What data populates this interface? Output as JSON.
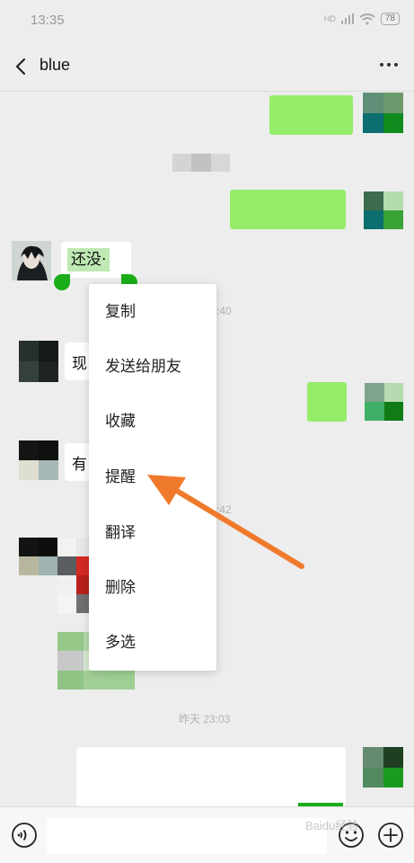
{
  "status_bar": {
    "time": "13:35",
    "network_label": "HD",
    "battery": "78"
  },
  "header": {
    "title": "blue",
    "back_icon": "chevron-left-icon",
    "more_icon": "ellipsis-icon"
  },
  "messages": {
    "partial_text_1": "还没·",
    "partial_text_2": "现",
    "partial_text_3": "有",
    "partial_time_1": ":40",
    "partial_time_2": ":42",
    "timestamp_3": "昨天 23:03"
  },
  "context_menu": {
    "items": [
      "复制",
      "发送给朋友",
      "收藏",
      "提醒",
      "翻译",
      "删除",
      "多选"
    ]
  },
  "input_bar": {
    "voice_icon": "voice-icon",
    "emoji_icon": "emoji-icon",
    "plus_icon": "plus-icon"
  },
  "annotation": {
    "arrow_color": "#f07a2c",
    "arrow_target": "提醒"
  },
  "watermark": "Baidu经验",
  "colors": {
    "background": "#ededed",
    "sent_bubble": "#95ec69",
    "received_bubble": "#ffffff",
    "selection_handle": "#1aad19"
  }
}
